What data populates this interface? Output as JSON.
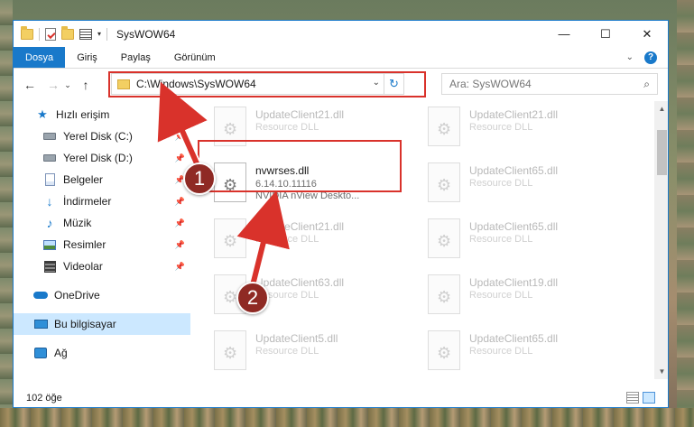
{
  "window": {
    "title": "SysWOW64",
    "minimize": "—",
    "maximize": "☐",
    "close": "✕"
  },
  "ribbon": {
    "tabs": [
      "Dosya",
      "Giriş",
      "Paylaş",
      "Görünüm"
    ],
    "active_tab": "Dosya",
    "expand": "⌄",
    "help": "?"
  },
  "nav": {
    "back": "←",
    "forward": "→",
    "recent": "⌄",
    "up": "↑"
  },
  "address": {
    "path": "C:\\Windows\\SysWOW64",
    "dropdown": "⌄",
    "refresh": "↻"
  },
  "search": {
    "placeholder": "Ara: SysWOW64",
    "icon": "⌕"
  },
  "sidebar": {
    "items": [
      {
        "label": "Hızlı erişim",
        "icon": "star-icon",
        "pinned": false
      },
      {
        "label": "Yerel Disk (C:)",
        "icon": "drive-icon",
        "pinned": true
      },
      {
        "label": "Yerel Disk (D:)",
        "icon": "drive-icon",
        "pinned": true
      },
      {
        "label": "Belgeler",
        "icon": "documents-icon",
        "pinned": true
      },
      {
        "label": "İndirmeler",
        "icon": "download-icon",
        "pinned": true
      },
      {
        "label": "Müzik",
        "icon": "music-icon",
        "pinned": true
      },
      {
        "label": "Resimler",
        "icon": "pictures-icon",
        "pinned": true
      },
      {
        "label": "Videolar",
        "icon": "videos-icon",
        "pinned": true
      },
      {
        "label": "OneDrive",
        "icon": "onedrive-icon",
        "pinned": false
      },
      {
        "label": "Bu bilgisayar",
        "icon": "this-pc-icon",
        "pinned": false,
        "selected": true
      },
      {
        "label": "Ağ",
        "icon": "network-icon",
        "pinned": false
      }
    ],
    "pin_glyph": "📌"
  },
  "files": {
    "left_column": [
      {
        "name": "UpdateClient21.dll",
        "desc": "Resource DLL",
        "faded": true
      },
      {
        "name": "nvwrses.dll",
        "version": "6.14.10.11116",
        "desc": "NVIDIA nView Deskto...",
        "faded": false
      },
      {
        "name": "UpdateClient21.dll",
        "desc": "Resource DLL",
        "faded": true
      },
      {
        "name": "UpdateClient63.dll",
        "desc": "Resource DLL",
        "faded": true
      },
      {
        "name": "UpdateClient5.dll",
        "desc": "Resource DLL",
        "faded": true
      }
    ],
    "right_column": [
      {
        "name": "UpdateClient21.dll",
        "desc": "Resource DLL",
        "faded": true
      },
      {
        "name": "UpdateClient65.dll",
        "desc": "Resource DLL",
        "faded": true
      },
      {
        "name": "UpdateClient65.dll",
        "desc": "Resource DLL",
        "faded": true
      },
      {
        "name": "UpdateClient19.dll",
        "desc": "Resource DLL",
        "faded": true
      },
      {
        "name": "UpdateClient65.dll",
        "desc": "Resource DLL",
        "faded": true
      }
    ]
  },
  "status": {
    "item_count": "102 öğe"
  },
  "callouts": {
    "step1": "1",
    "step2": "2",
    "color": "#d9322b"
  },
  "colors": {
    "accent": "#1979ca",
    "selection": "#cce8ff",
    "highlight": "#d9322b"
  }
}
